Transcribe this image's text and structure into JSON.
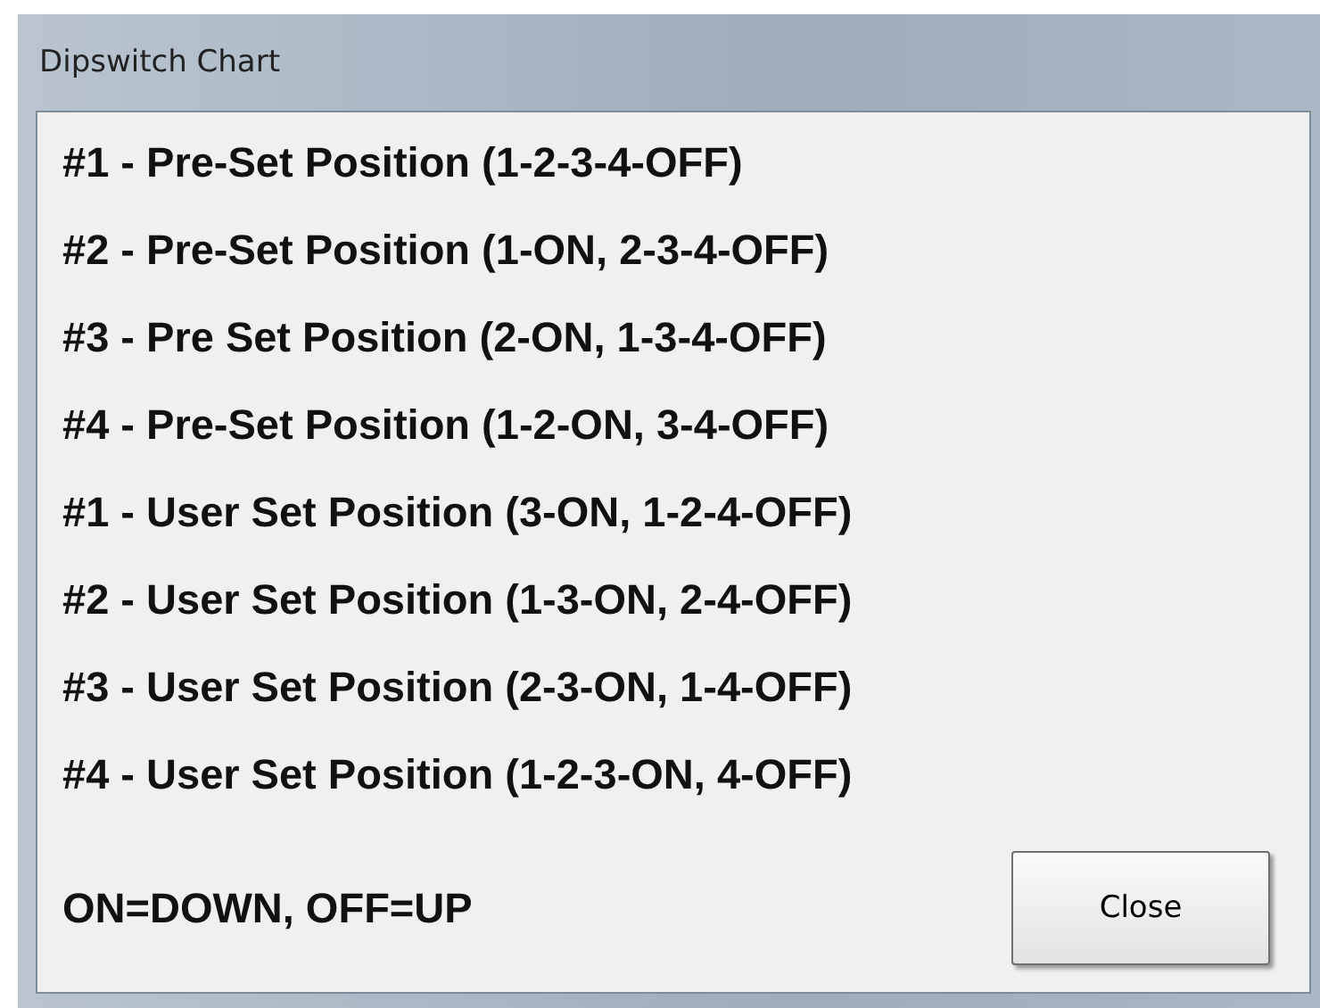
{
  "window": {
    "title": "Dipswitch Chart"
  },
  "positions": [
    "#1 - Pre-Set Position (1-2-3-4-OFF)",
    "#2 - Pre-Set Position (1-ON, 2-3-4-OFF)",
    "#3 - Pre Set Position (2-ON, 1-3-4-OFF)",
    "#4 - Pre-Set Position (1-2-ON, 3-4-OFF)",
    "#1 - User Set Position (3-ON, 1-2-4-OFF)",
    "#2 - User Set Position (1-3-ON, 2-4-OFF)",
    "#3 - User Set Position (2-3-ON, 1-4-OFF)",
    "#4 - User Set Position (1-2-3-ON, 4-OFF)"
  ],
  "legend": "ON=DOWN, OFF=UP",
  "buttons": [
    "Close"
  ]
}
